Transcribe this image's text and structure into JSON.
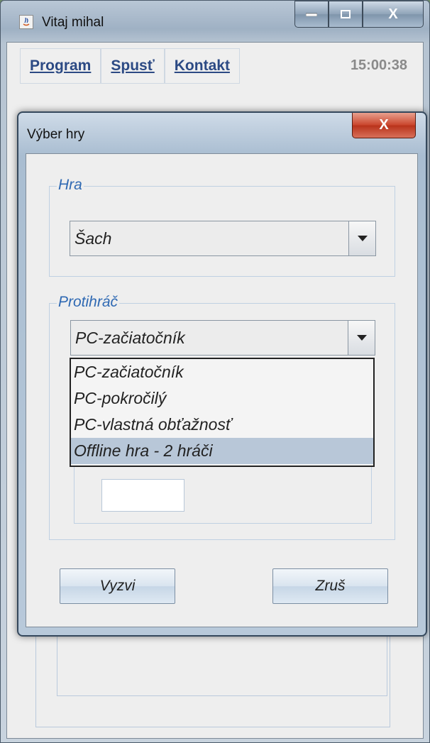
{
  "outer_window": {
    "title": "Vitaj mihal",
    "icon": "java-icon",
    "caption_buttons": {
      "minimize": "minimize-icon",
      "maximize": "maximize-icon",
      "close": "X"
    }
  },
  "menubar": {
    "items": [
      {
        "label": "Program"
      },
      {
        "label": "Spusť"
      },
      {
        "label": "Kontakt"
      }
    ],
    "clock": "15:00:38"
  },
  "dialog": {
    "title": "Výber hry",
    "close": "X",
    "game_group": {
      "legend": "Hra",
      "selected": "Šach"
    },
    "opponent_group": {
      "legend": "Protihráč",
      "selected": "PC-začiatočník",
      "options": [
        {
          "label": "PC-začiatočník"
        },
        {
          "label": "PC-pokročilý"
        },
        {
          "label": "PC-vlastná obťažnosť"
        },
        {
          "label": "Offline hra - 2 hráči"
        }
      ],
      "highlighted_index": 3
    },
    "challenge_button": "Vyzvi",
    "cancel_button": "Zruš"
  },
  "colors": {
    "legend": "#2f69b3",
    "menu_text": "#2c4a84",
    "close_button": "#c9442b",
    "highlight": "#b8c7d8"
  }
}
